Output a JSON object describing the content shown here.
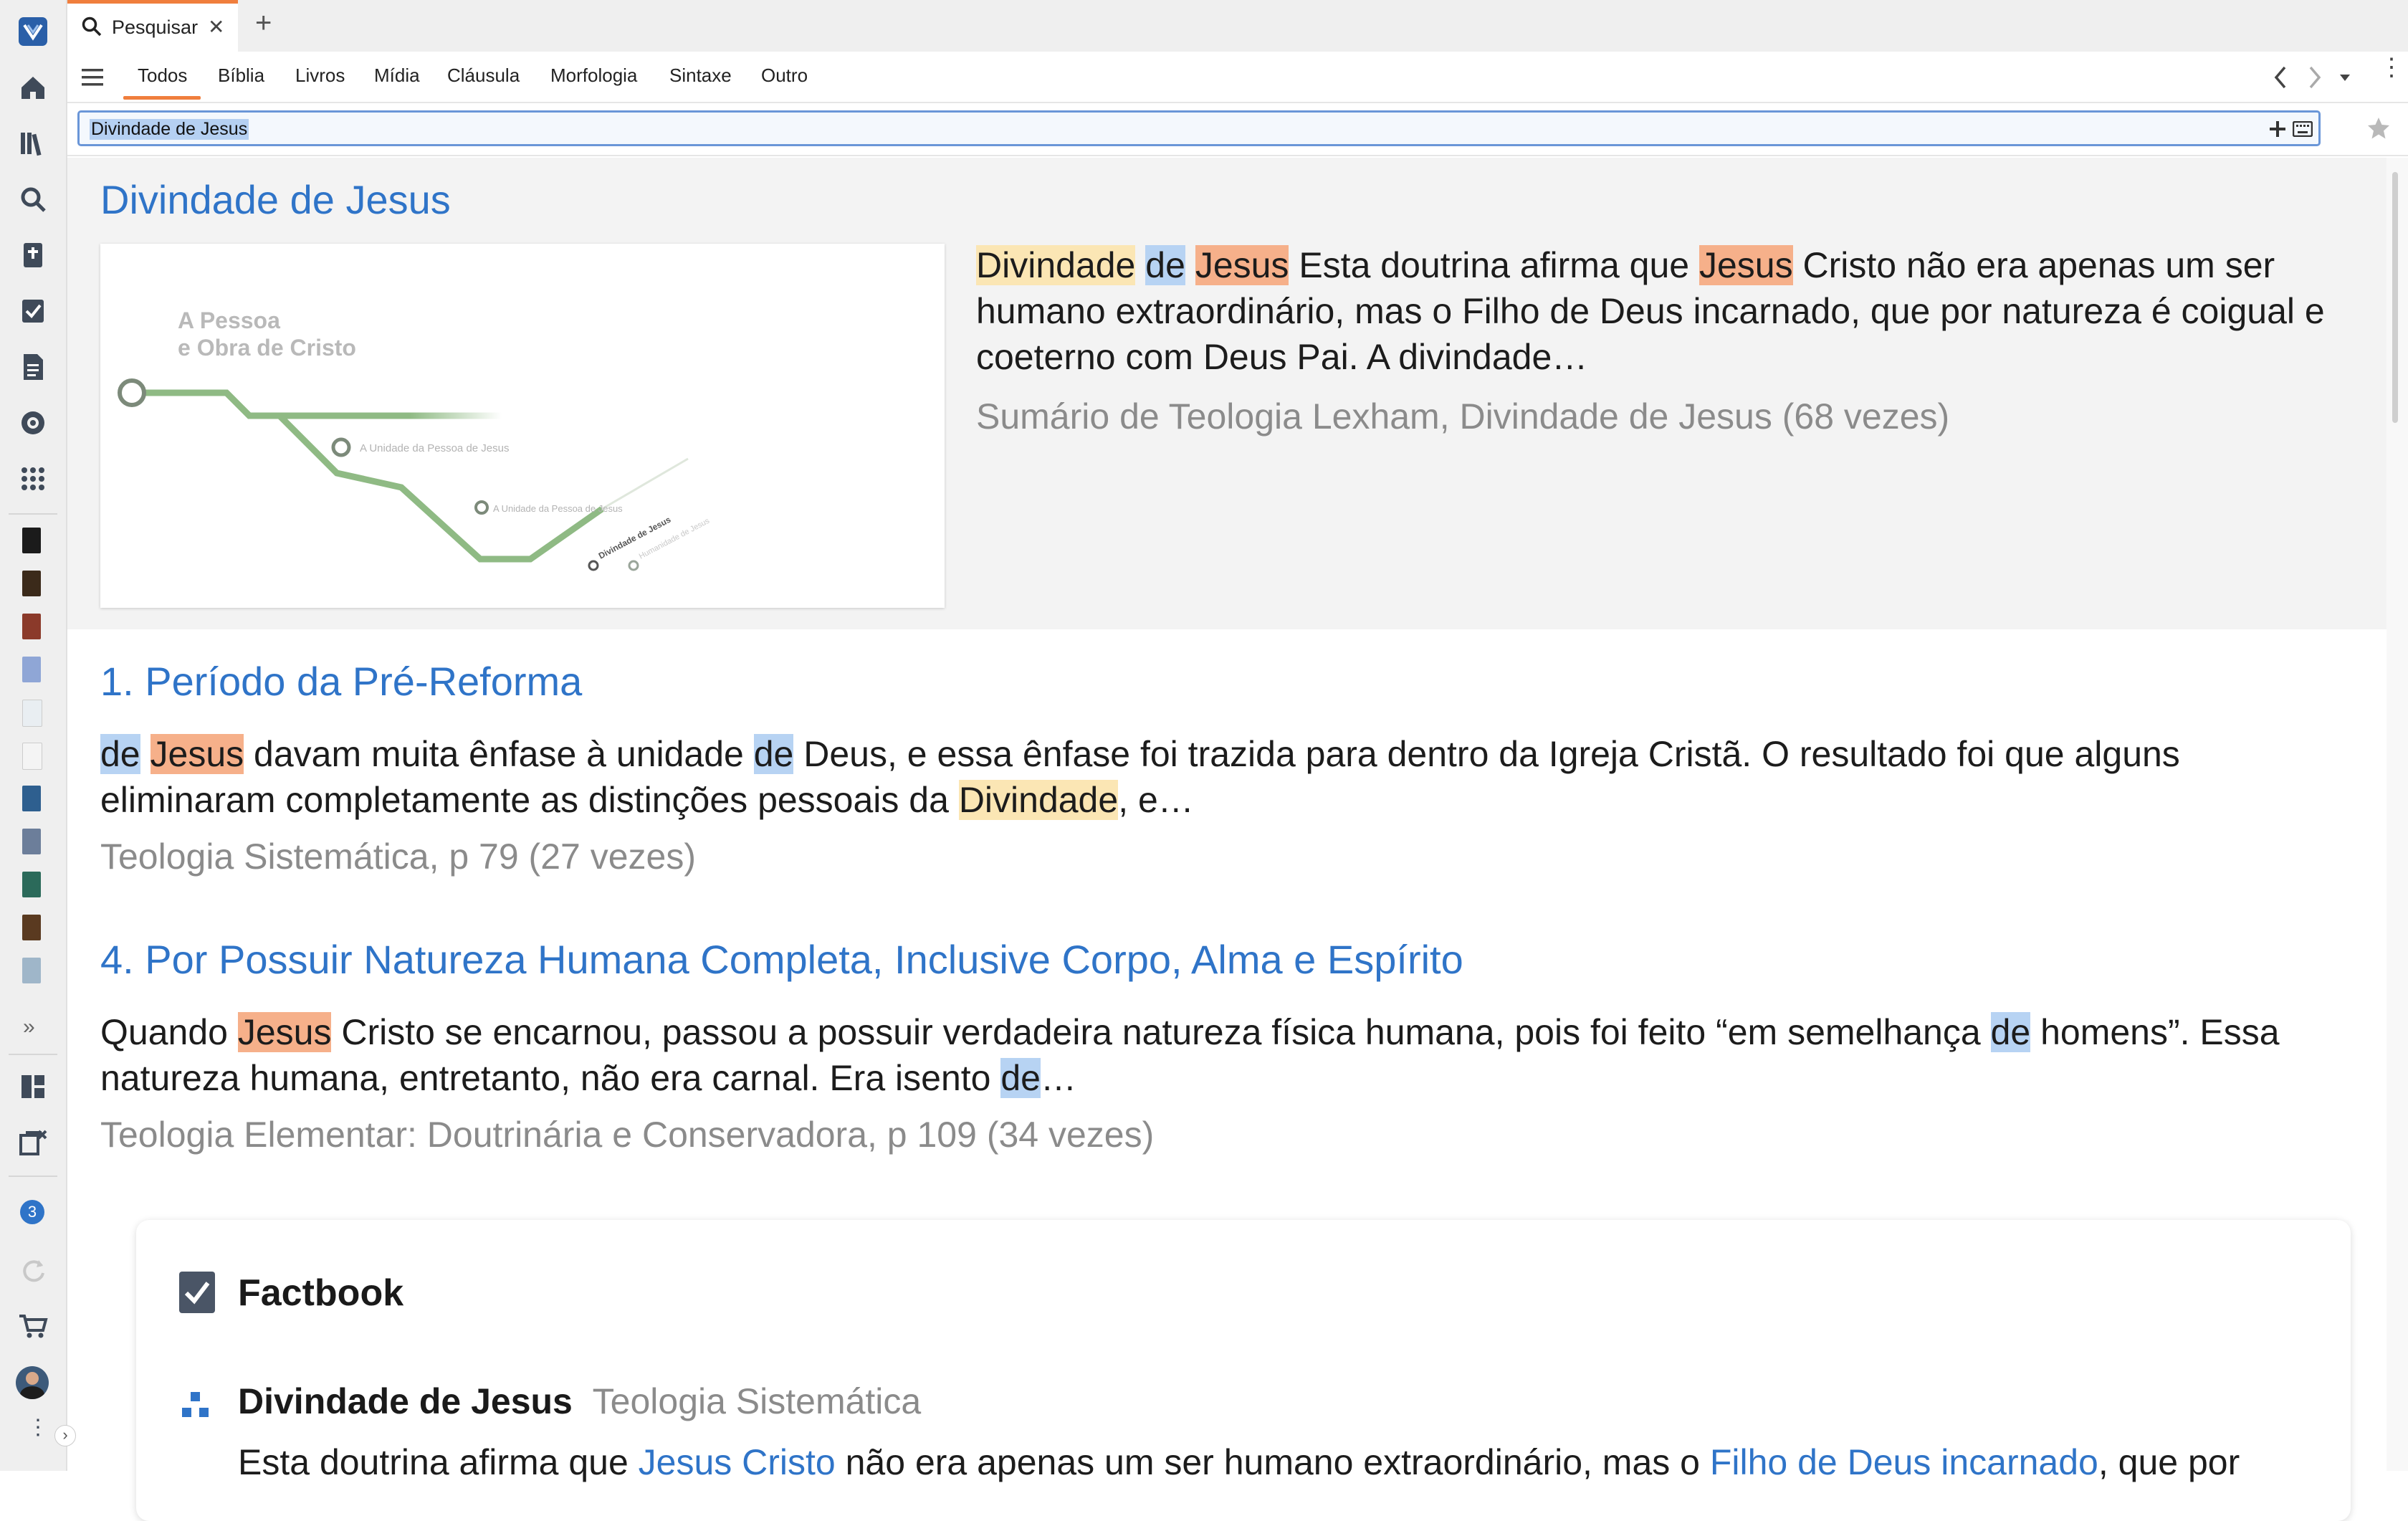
{
  "tab": {
    "title": "Pesquisar",
    "close_glyph": "✕",
    "new_glyph": "+"
  },
  "categories": [
    "Todos",
    "Bíblia",
    "Livros",
    "Mídia",
    "Cláusula",
    "Morfologia",
    "Sintaxe",
    "Outro"
  ],
  "search": {
    "value": "Divindade de Jesus"
  },
  "rail": {
    "more_glyph": "»",
    "notification_count": "3",
    "collapse_glyph": "›"
  },
  "results": {
    "featured": {
      "title": "Divindade de Jesus",
      "snippet": {
        "w1": "Divindade",
        "w2": "de",
        "w3": "Jesus",
        "t1": " Esta doutrina afirma que ",
        "w4": "Jesus",
        "t2": " Cristo não era apenas um ser humano extraordinário, mas o Filho de Deus incarnado, que por natureza é coigual e coeterno com Deus Pai. A divindade…"
      },
      "source": "Sumário de Teologia Lexham, Divindade de Jesus (68 vezes)",
      "image": {
        "title_line1": "A Pessoa",
        "title_line2": "e Obra de Cristo",
        "label1": "A Unidade da Pessoa de Jesus",
        "label2": "A Unidade da Pessoa de Jesus",
        "label3": "Divindade de Jesus",
        "label4": "Humanidade de Jesus"
      }
    },
    "item1": {
      "title": "1. Período da Pré-Reforma",
      "w1": "de",
      "w2": "Jesus",
      "t1": " davam muita ênfase à unidade ",
      "w3": "de",
      "t2": " Deus, e essa ênfase foi trazida para dentro da Igreja Cristã. O resultado foi que alguns",
      "t3": "eliminaram completamente as distinções pessoais da ",
      "w4": "Divindade",
      "t4": ", e…",
      "source": "Teologia Sistemática, p 79 (27 vezes)"
    },
    "item2": {
      "title": "4. Por Possuir Natureza Humana Completa, Inclusive Corpo, Alma e Espírito",
      "t0": "Quando ",
      "w1": "Jesus",
      "t1": " Cristo se encarnou, passou a possuir verdadeira natureza física humana, pois foi feito “em semelhança ",
      "w2": "de",
      "t2": " homens”. Essa",
      "t3": "natureza humana, entretanto, não era carnal. Era isento ",
      "w3": "de",
      "t4": "…",
      "source": "Teologia Elementar: Doutrinária e Conservadora, p 109 (34 vezes)"
    }
  },
  "factbook": {
    "heading": "Factbook",
    "entry_title": "Divindade de Jesus",
    "entry_subtitle": "Teologia Sistemática",
    "t1": "Esta doutrina afirma que ",
    "link1": "Jesus Cristo",
    "t2": " não era apenas um ser humano extraordinário, mas o ",
    "link2": "Filho de Deus incarnado",
    "t3": ", que por"
  }
}
